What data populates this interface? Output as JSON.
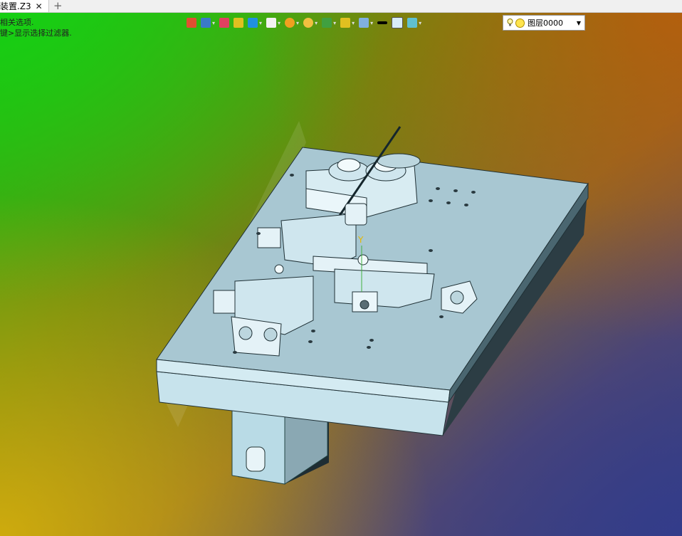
{
  "tab": {
    "title": "装置.Z3",
    "close": "✕",
    "new_tab": "+"
  },
  "hints": {
    "line1": "相关选项.",
    "line2": "键>显示选择过滤器."
  },
  "toolbar": {
    "items": [
      {
        "icon": "insert-icon",
        "color": "#e05030"
      },
      {
        "icon": "view-cube-icon",
        "color": "#3a7ac8"
      },
      {
        "icon": "pen-icon",
        "color": "#e04060"
      },
      {
        "icon": "box-stack-icon",
        "color": "#e0c020"
      },
      {
        "icon": "solid-cube-icon",
        "color": "#2090e0"
      },
      {
        "icon": "white-cube-icon",
        "color": "#f2f2f2"
      },
      {
        "icon": "render-mode-icon",
        "color": "#f0a020"
      },
      {
        "icon": "zoom-icon",
        "color": "#f0c040"
      },
      {
        "icon": "fit-view-icon",
        "color": "#40a040"
      },
      {
        "icon": "section-icon",
        "color": "#e0c020"
      },
      {
        "icon": "display-icon",
        "color": "#80b0e0"
      },
      {
        "icon": "line-width-icon",
        "color": "#000000"
      },
      {
        "icon": "color-swatch-icon",
        "color": "#d8ecf8"
      },
      {
        "icon": "layer-stack-icon",
        "color": "#60c0d0"
      }
    ]
  },
  "layer": {
    "name": "图层0000"
  },
  "model": {
    "label_y": "Y"
  }
}
